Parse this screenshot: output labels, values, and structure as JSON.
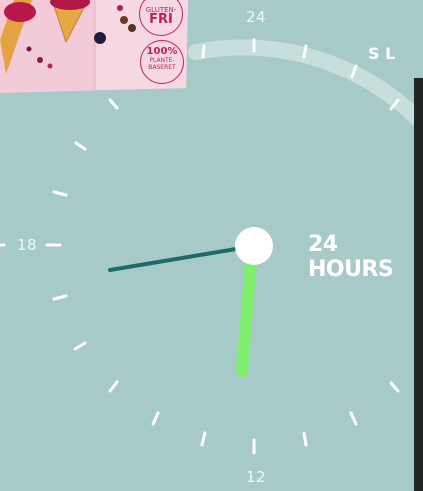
{
  "clock": {
    "label_24": "24",
    "label_18": "18",
    "label_12": "12",
    "complication_label": "24 HOURS",
    "arc_text": "S L",
    "hour_hand_angle_deg": 188,
    "second_hand_angle_deg": 258
  },
  "product": {
    "badge_gluten_top": "GLUTEN-",
    "badge_gluten_bottom": "FRI",
    "badge_vegan_top": "100%",
    "badge_vegan_bottom": "PLANTE-BASERET"
  },
  "colors": {
    "background": "#a7cac8",
    "hour_hand": "#7dee6e",
    "second_hand": "#1d6a6b",
    "tick": "#ffffff",
    "arc": "#e6f0ef",
    "badge": "#c21d5f",
    "package": "#f0c9d6"
  },
  "icons": {
    "center_pin": "circle-icon"
  }
}
